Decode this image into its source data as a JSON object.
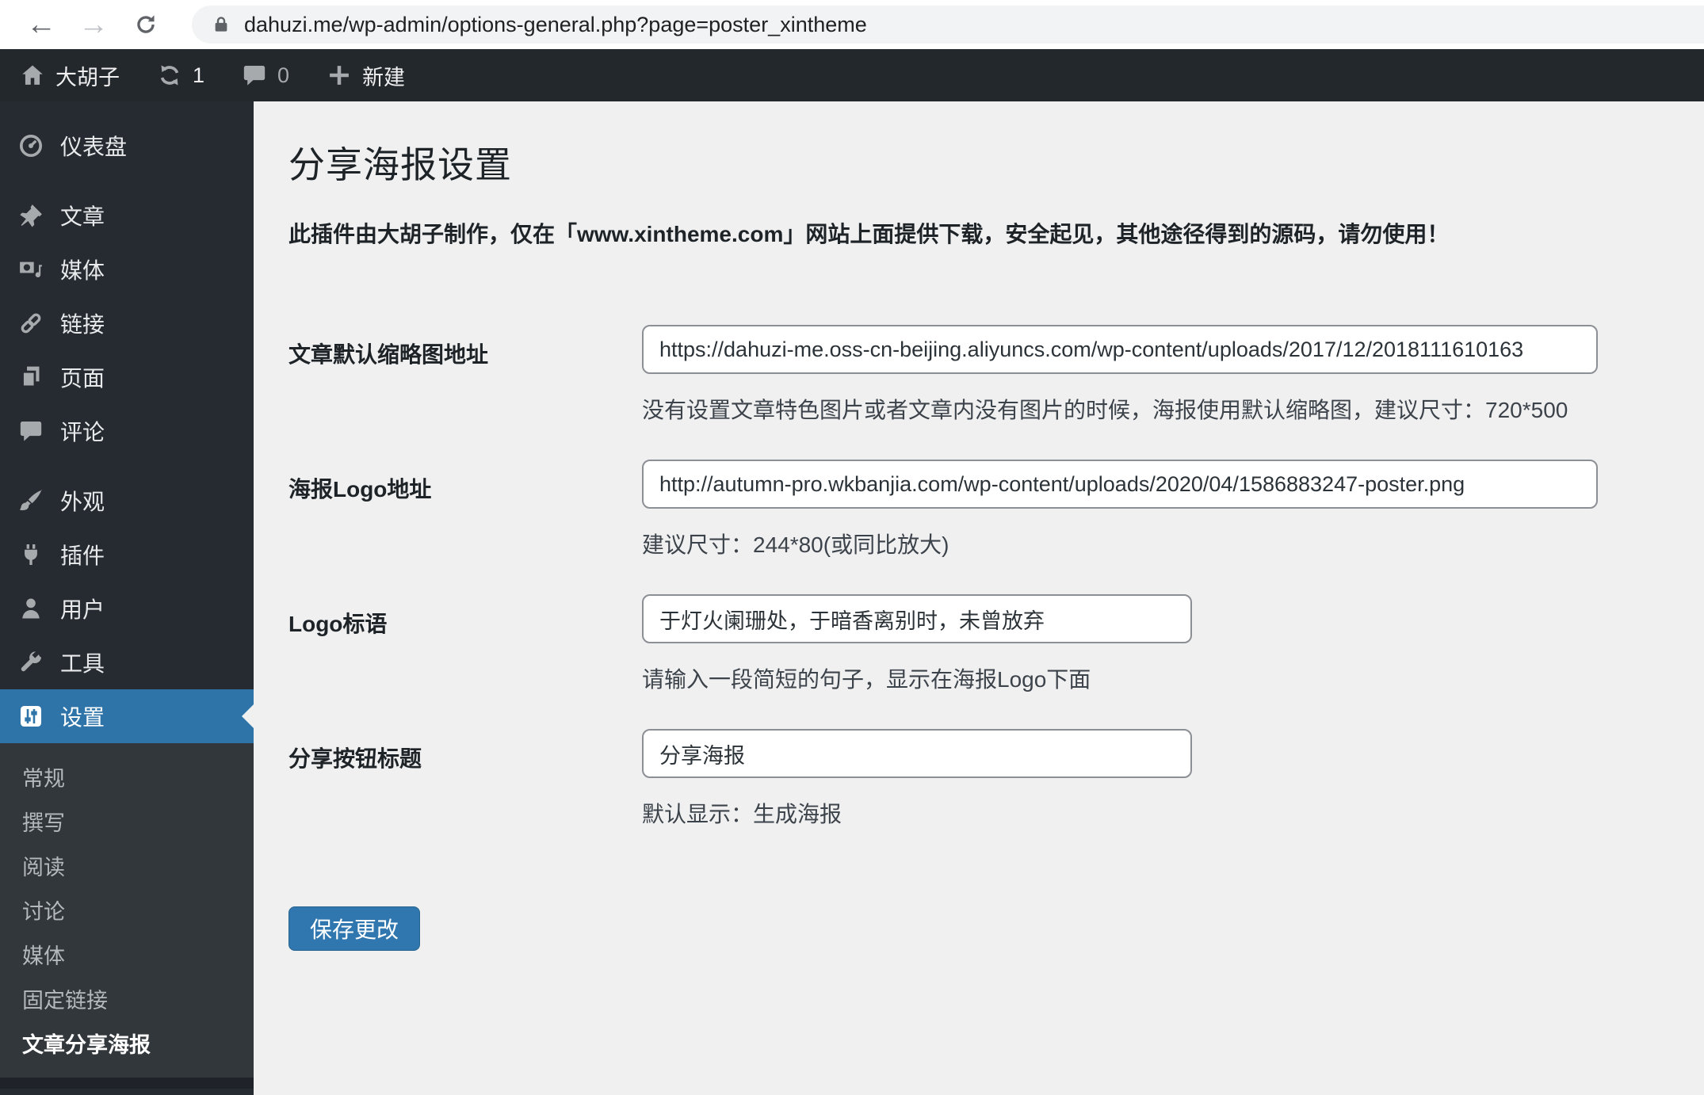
{
  "browser": {
    "url": "dahuzi.me/wp-admin/options-general.php?page=poster_xintheme"
  },
  "admin_bar": {
    "site_name": "大胡子",
    "update_count": "1",
    "comment_count": "0",
    "new_label": "新建"
  },
  "sidebar": {
    "items": [
      {
        "label": "仪表盘"
      },
      {
        "label": "文章"
      },
      {
        "label": "媒体"
      },
      {
        "label": "链接"
      },
      {
        "label": "页面"
      },
      {
        "label": "评论"
      },
      {
        "label": "外观"
      },
      {
        "label": "插件"
      },
      {
        "label": "用户"
      },
      {
        "label": "工具"
      },
      {
        "label": "设置"
      }
    ],
    "active_item": "设置",
    "submenu": [
      {
        "label": "常规"
      },
      {
        "label": "撰写"
      },
      {
        "label": "阅读"
      },
      {
        "label": "讨论"
      },
      {
        "label": "媒体"
      },
      {
        "label": "固定链接"
      },
      {
        "label": "文章分享海报"
      }
    ],
    "current_submenu": "文章分享海报"
  },
  "main": {
    "title": "分享海报设置",
    "notice": "此插件由大胡子制作，仅在「www.xintheme.com」网站上面提供下载，安全起见，其他途径得到的源码，请勿使用！",
    "fields": [
      {
        "label": "文章默认缩略图地址",
        "value": "https://dahuzi-me.oss-cn-beijing.aliyuncs.com/wp-content/uploads/2017/12/2018111610163",
        "help": "没有设置文章特色图片或者文章内没有图片的时候，海报使用默认缩略图，建议尺寸：720*500"
      },
      {
        "label": "海报Logo地址",
        "value": "http://autumn-pro.wkbanjia.com/wp-content/uploads/2020/04/1586883247-poster.png",
        "help": "建议尺寸：244*80(或同比放大)"
      },
      {
        "label": "Logo标语",
        "value": "于灯火阑珊处，于暗香离别时，未曾放弃",
        "help": "请输入一段简短的句子，显示在海报Logo下面"
      },
      {
        "label": "分享按钮标题",
        "value": "分享海报",
        "help": "默认显示：生成海报"
      }
    ],
    "save_label": "保存更改"
  },
  "colors": {
    "sidebar_active": "#2e74a8",
    "button_blue": "#2f77ae",
    "sidebar_bg": "#262b31",
    "submenu_bg": "#32373c",
    "content_bg": "#f0f0f1"
  }
}
